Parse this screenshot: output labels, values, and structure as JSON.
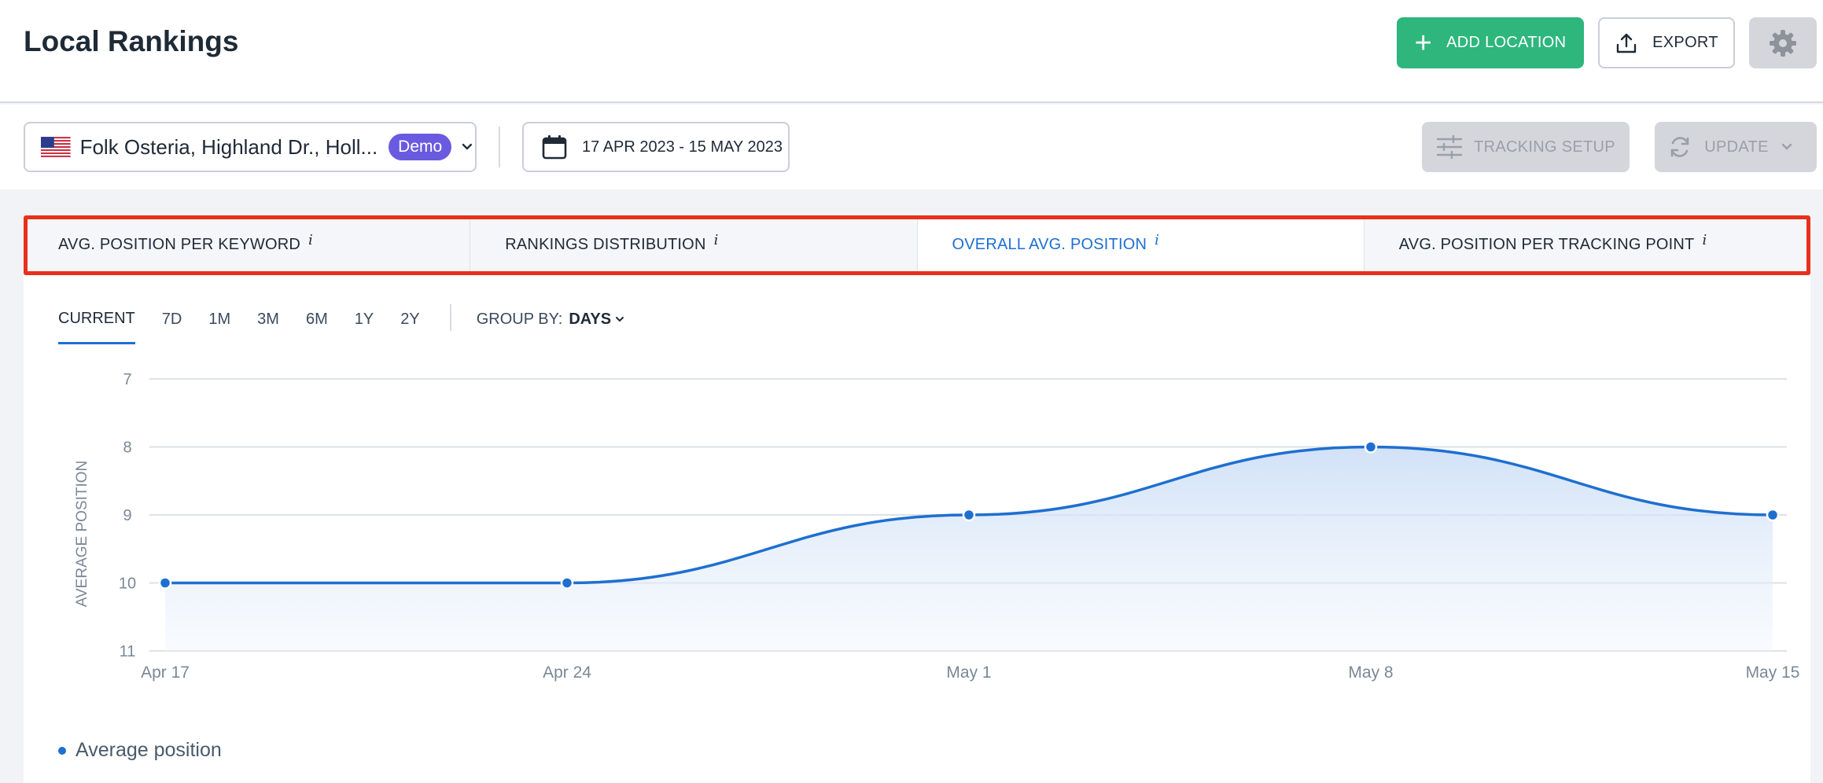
{
  "header": {
    "title": "Local Rankings",
    "add_location_label": "ADD LOCATION",
    "export_label": "EXPORT"
  },
  "toolbar": {
    "location_name": "Folk Osteria, Highland Dr., Holl...",
    "demo_badge": "Demo",
    "date_range": "17 APR 2023 - 15 MAY 2023",
    "tracking_setup_label": "TRACKING SETUP",
    "update_label": "UPDATE"
  },
  "tabs": [
    {
      "label": "AVG. POSITION PER KEYWORD",
      "info": "i"
    },
    {
      "label": "RANKINGS DISTRIBUTION",
      "info": "i"
    },
    {
      "label": "OVERALL AVG. POSITION",
      "info": "i"
    },
    {
      "label": "AVG. POSITION PER TRACKING POINT",
      "info": "i"
    }
  ],
  "active_tab": 2,
  "periods": [
    "CURRENT",
    "7D",
    "1M",
    "3M",
    "6M",
    "1Y",
    "2Y"
  ],
  "active_period": 0,
  "group_by": {
    "label": "GROUP BY:",
    "value": "DAYS"
  },
  "colors": {
    "accent": "#1e6fd0",
    "add_button": "#2eb67d",
    "demo_badge": "#6a5ae0",
    "highlight": "#e8301c"
  },
  "icons": {
    "add": "plus-icon",
    "export": "upload-icon",
    "settings": "gear-icon",
    "calendar": "calendar-icon",
    "tracking": "sliders-icon",
    "update": "refresh-icon"
  },
  "chart_data": {
    "type": "area",
    "x": [
      "Apr 17",
      "Apr 24",
      "May 1",
      "May 8",
      "May 15"
    ],
    "series": [
      {
        "name": "Average position",
        "values": [
          10,
          10,
          9,
          8,
          9
        ]
      }
    ],
    "ylabel": "AVERAGE POSITION",
    "y_ticks": [
      7,
      8,
      9,
      10,
      11
    ],
    "ylim": [
      7,
      11
    ],
    "y_inverted": true,
    "grid": true,
    "legend": "bottom-left"
  }
}
